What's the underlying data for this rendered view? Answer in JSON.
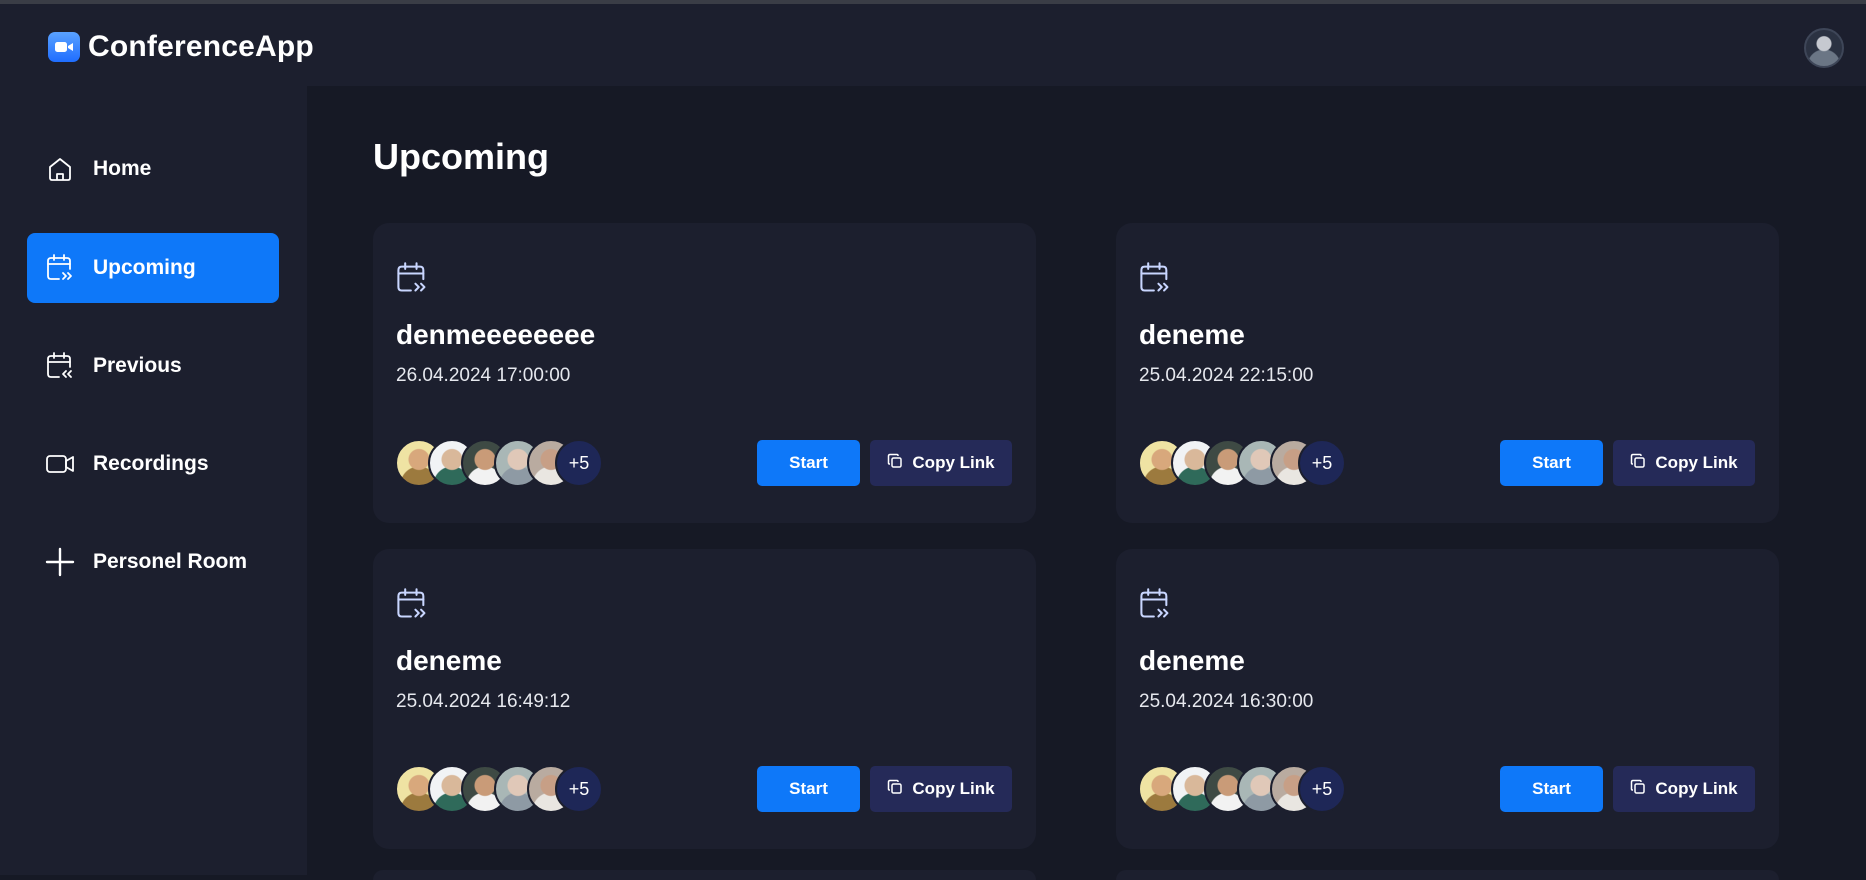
{
  "app": {
    "name": "ConferenceApp"
  },
  "header": {
    "avatar_icon": "user-avatar-icon"
  },
  "sidebar": {
    "items": [
      {
        "label": "Home",
        "icon": "home-icon",
        "active": false
      },
      {
        "label": "Upcoming",
        "icon": "calendar-upcoming-icon",
        "active": true
      },
      {
        "label": "Previous",
        "icon": "calendar-previous-icon",
        "active": false
      },
      {
        "label": "Recordings",
        "icon": "video-icon",
        "active": false
      },
      {
        "label": "Personel Room",
        "icon": "plus-icon",
        "active": false
      }
    ]
  },
  "main": {
    "title": "Upcoming",
    "meetings": [
      {
        "title": "denmeeeeeeee",
        "date": "26.04.2024 17:00:00",
        "more_count": "+5",
        "start_label": "Start",
        "copy_label": "Copy Link"
      },
      {
        "title": "deneme",
        "date": "25.04.2024 22:15:00",
        "more_count": "+5",
        "start_label": "Start",
        "copy_label": "Copy Link"
      },
      {
        "title": "deneme",
        "date": "25.04.2024 16:49:12",
        "more_count": "+5",
        "start_label": "Start",
        "copy_label": "Copy Link"
      },
      {
        "title": "deneme",
        "date": "25.04.2024 16:30:00",
        "more_count": "+5",
        "start_label": "Start",
        "copy_label": "Copy Link"
      }
    ]
  },
  "colors": {
    "accent": "#0e78f9",
    "surface": "#1c1f2e",
    "background": "#161925",
    "secondary_button": "#252a58"
  }
}
